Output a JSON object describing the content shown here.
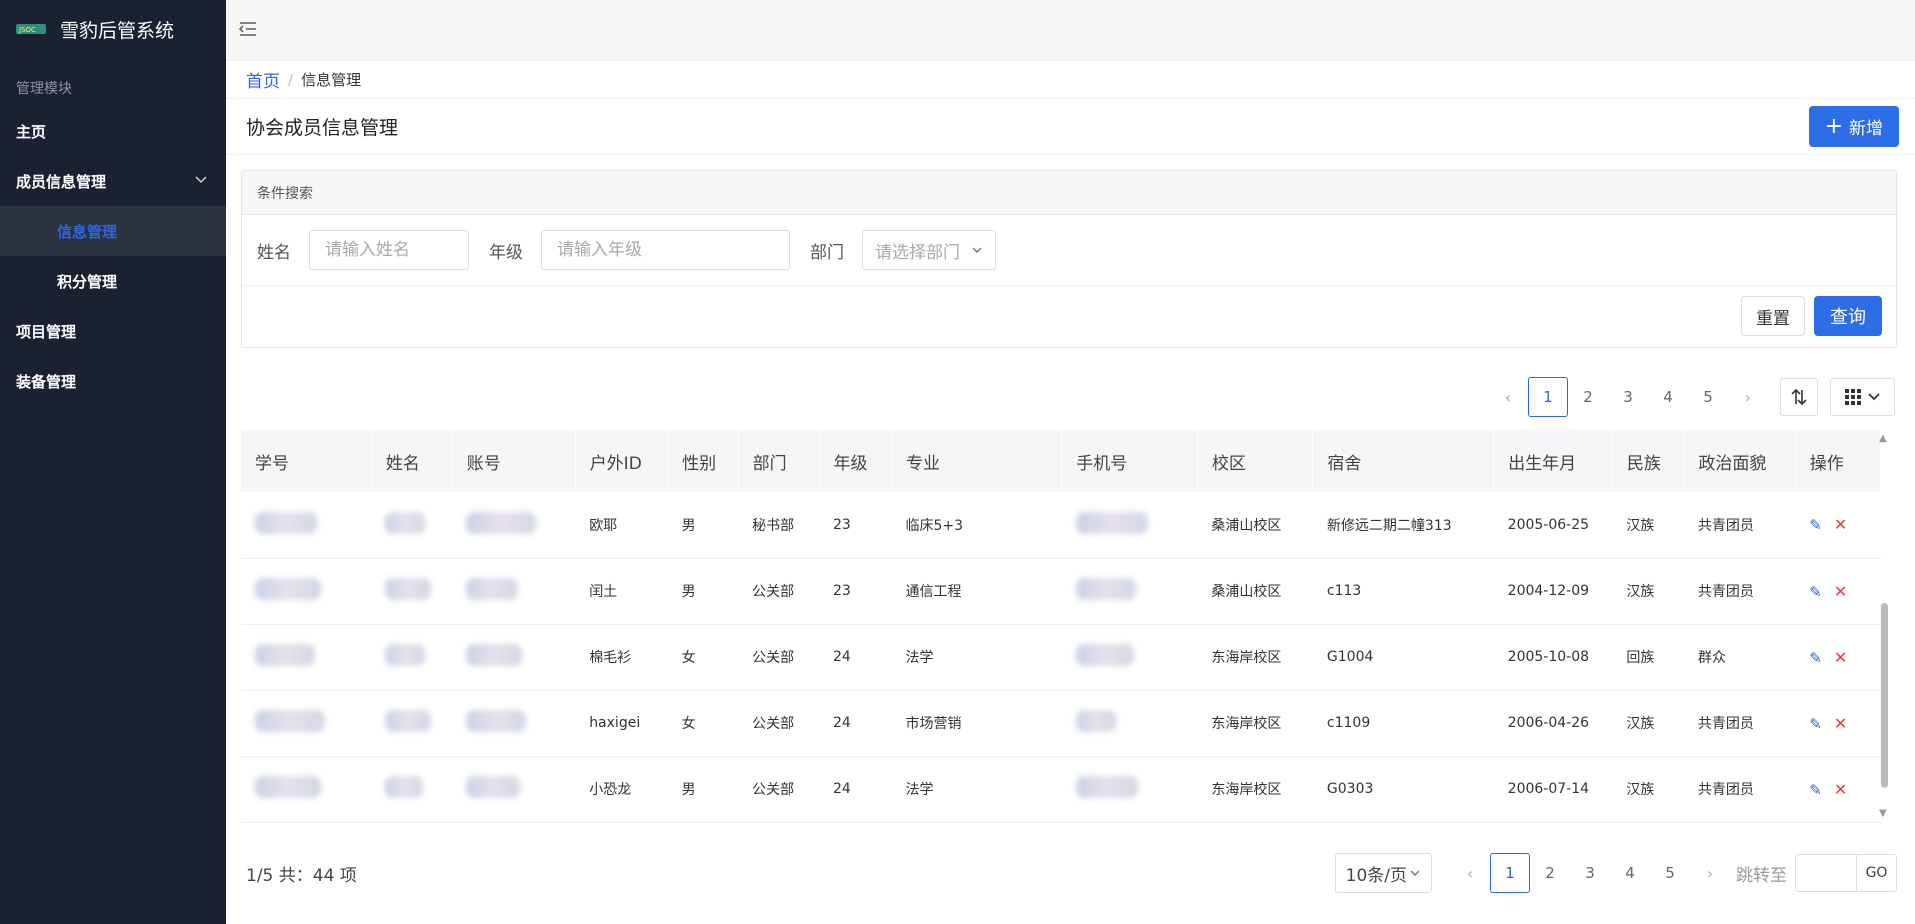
{
  "app": {
    "title": "雪豹后管系统",
    "logo_text": "JSOC"
  },
  "sidebar": {
    "group_label": "管理模块",
    "items": [
      {
        "label": "主页"
      },
      {
        "label": "成员信息管理",
        "expanded": true,
        "children": [
          {
            "label": "信息管理",
            "active": true
          },
          {
            "label": "积分管理"
          }
        ]
      },
      {
        "label": "项目管理"
      },
      {
        "label": "装备管理"
      }
    ]
  },
  "breadcrumb": {
    "home": "首页",
    "separator": "/",
    "current": "信息管理"
  },
  "page": {
    "title": "协会成员信息管理",
    "add_label": "新增"
  },
  "search": {
    "header": "条件搜索",
    "name_label": "姓名",
    "name_placeholder": "请输入姓名",
    "grade_label": "年级",
    "grade_placeholder": "请输入年级",
    "dept_label": "部门",
    "dept_placeholder": "请选择部门",
    "reset_label": "重置",
    "query_label": "查询"
  },
  "pager": {
    "pages": [
      "1",
      "2",
      "3",
      "4",
      "5"
    ],
    "current": "1",
    "prev": "‹",
    "next": "›"
  },
  "table": {
    "columns": [
      "学号",
      "姓名",
      "账号",
      "户外ID",
      "性别",
      "部门",
      "年级",
      "专业",
      "手机号",
      "校区",
      "宿舍",
      "出生年月",
      "民族",
      "政治面貌",
      "操作"
    ],
    "rows": [
      {
        "outdoor_id": "欧耶",
        "gender": "男",
        "dept": "秘书部",
        "grade": "23",
        "major": "临床5+3",
        "campus": "桑浦山校区",
        "dorm": "新修远二期二幢313",
        "birth": "2005-06-25",
        "ethnic": "汉族",
        "political": "共青团员"
      },
      {
        "outdoor_id": "闰土",
        "gender": "男",
        "dept": "公关部",
        "grade": "23",
        "major": "通信工程",
        "campus": "桑浦山校区",
        "dorm": "c113",
        "birth": "2004-12-09",
        "ethnic": "汉族",
        "political": "共青团员"
      },
      {
        "outdoor_id": "棉毛衫",
        "gender": "女",
        "dept": "公关部",
        "grade": "24",
        "major": "法学",
        "campus": "东海岸校区",
        "dorm": "G1004",
        "birth": "2005-10-08",
        "ethnic": "回族",
        "political": "群众"
      },
      {
        "outdoor_id": "haxigei",
        "gender": "女",
        "dept": "公关部",
        "grade": "24",
        "major": "市场营销",
        "campus": "东海岸校区",
        "dorm": "c1109",
        "birth": "2006-04-26",
        "ethnic": "汉族",
        "political": "共青团员"
      },
      {
        "outdoor_id": "小恐龙",
        "gender": "男",
        "dept": "公关部",
        "grade": "24",
        "major": "法学",
        "campus": "东海岸校区",
        "dorm": "G0303",
        "birth": "2006-07-14",
        "ethnic": "汉族",
        "political": "共青团员"
      }
    ]
  },
  "footer": {
    "total_text": "1/5 共：44 项",
    "page_size": "10条/页",
    "jump_label": "跳转至",
    "go_label": "GO"
  },
  "colors": {
    "primary": "#2d6ee8",
    "sidebar_bg": "#1a2130",
    "danger": "#e04040"
  }
}
